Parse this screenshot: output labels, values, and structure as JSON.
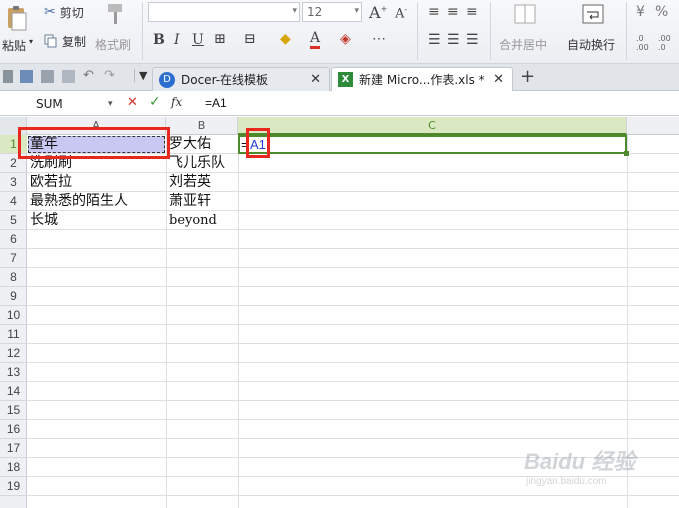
{
  "ribbon": {
    "cut_label": "剪切",
    "paste_label": "粘贴",
    "copy_label": "复制",
    "format_painter_label": "格式刷",
    "font_size_value": "12",
    "bold_label": "B",
    "italic_label": "I",
    "underline_label": "U",
    "merge_center_label": "合并居中",
    "wrap_text_label": "自动换行",
    "percent_label": "%",
    "increase_decimal_label": ".0 .00",
    "decrease_decimal_label": ".00 .0"
  },
  "tabs": [
    {
      "label": "Docer-在线模板"
    },
    {
      "label": "新建 Micro...作表.xls *"
    }
  ],
  "formula_bar": {
    "name_box": "SUM",
    "fx_label": "fx",
    "formula": "=A1"
  },
  "columns": [
    "A",
    "B",
    "C"
  ],
  "rows": [
    "1",
    "2",
    "3",
    "4",
    "5",
    "6",
    "7",
    "8",
    "9",
    "10",
    "11",
    "12",
    "13",
    "14",
    "15",
    "16",
    "17",
    "18",
    "19"
  ],
  "cells": {
    "A1": "童年",
    "A2": "洗刷刷",
    "A3": "欧若拉",
    "A4": "最熟悉的陌生人",
    "A5": "长城",
    "B1": "罗大佑",
    "B2": "飞儿乐队",
    "B3": "刘若英",
    "B4": "萧亚轩",
    "B5": "beyond",
    "C1_prefix": "=",
    "C1_ref": "A1"
  },
  "watermark": {
    "brand": "Baidu 经验",
    "url": "jingyan.baidu.com"
  },
  "colors": {
    "active_header": "#dbe9c2",
    "active_border": "#4e8a2b",
    "highlight_box": "#e8281f",
    "range_fill": "#c9c8f2"
  }
}
